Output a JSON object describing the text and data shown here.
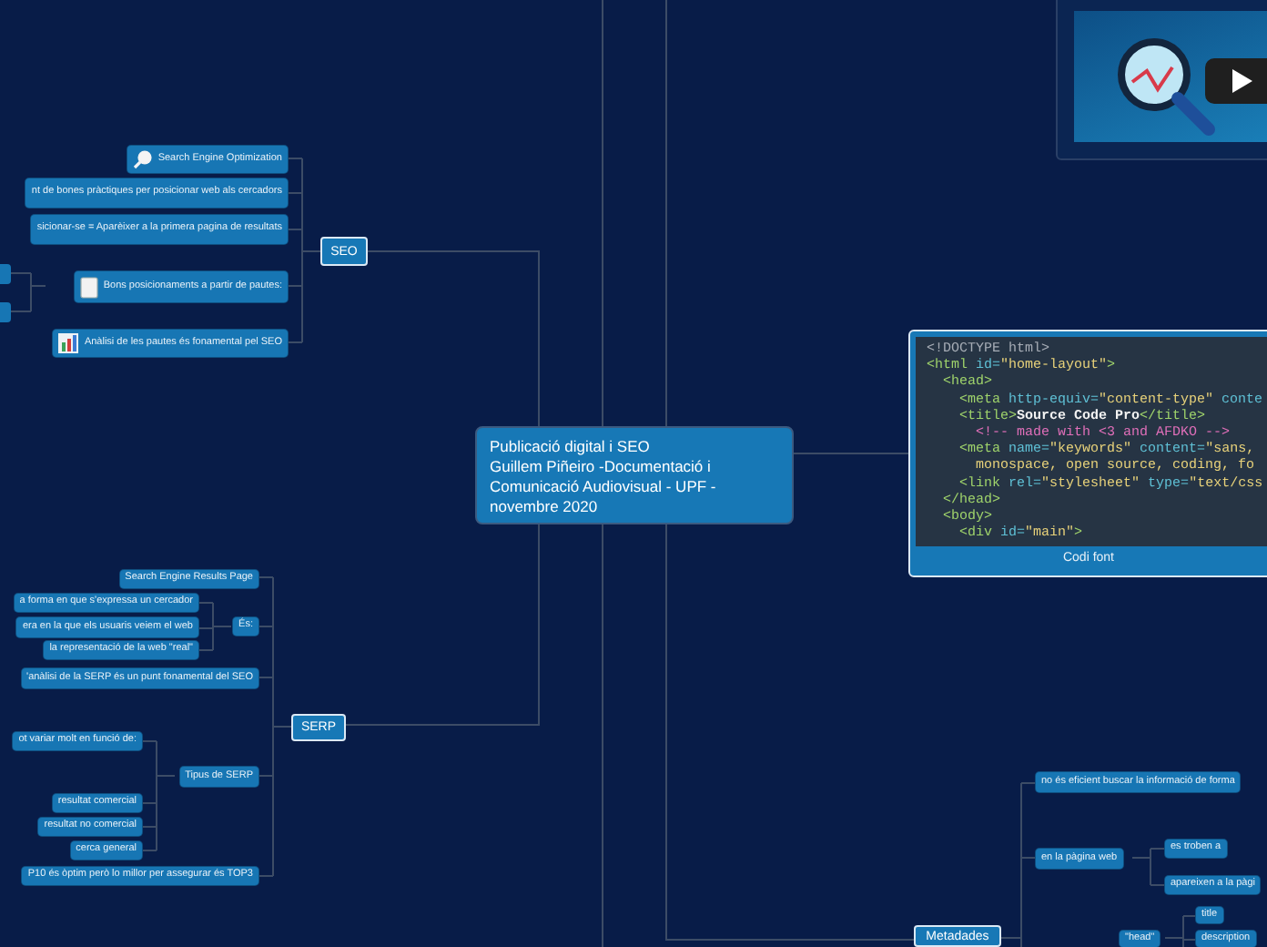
{
  "central_topic": {
    "text": "Publicació digital i SEO\nGuillem Piñeiro -Documentació i\nComunicació Audiovisual - UPF -\nnovembre 2020"
  },
  "nodes": [
    {
      "kind": "topic",
      "text": "Search Engine Optimization"
    },
    {
      "kind": "topic",
      "text": "nt de bones pràctiques per posicionar web als cercadors"
    },
    {
      "kind": "topic",
      "text": "sicionar-se = Aparèixer a la primera pagina de resultats"
    },
    {
      "kind": "main",
      "text": "SEO"
    },
    {
      "kind": "topic",
      "text": "Bons posicionaments a partir de pautes:"
    },
    {
      "kind": "topic",
      "text": "Anàlisi de les pautes és fonamental pel SEO"
    },
    {
      "kind": "topic",
      "text": "Search Engine Results Page"
    },
    {
      "kind": "topic",
      "text": "a forma en que s'expressa un cercador"
    },
    {
      "kind": "topic",
      "text": "era en la que els usuaris veiem el web"
    },
    {
      "kind": "topic",
      "text": "la representació de la web \"real\""
    },
    {
      "kind": "topic",
      "text": "És:"
    },
    {
      "kind": "topic",
      "text": "'anàlisi de la SERP és un punt fonamental del SEO"
    },
    {
      "kind": "main",
      "text": "SERP"
    },
    {
      "kind": "topic",
      "text": "ot variar molt en funció de:"
    },
    {
      "kind": "topic",
      "text": "Tipus de SERP"
    },
    {
      "kind": "topic",
      "text": "resultat comercial"
    },
    {
      "kind": "topic",
      "text": "resultat no comercial"
    },
    {
      "kind": "topic",
      "text": "cerca general"
    },
    {
      "kind": "topic",
      "text": "P10 és òptim però lo millor per assegurar és TOP3"
    },
    {
      "kind": "main",
      "text": "Metadades"
    },
    {
      "kind": "topic",
      "text": "no és eficient buscar la informació de forma"
    },
    {
      "kind": "topic",
      "text": "en la pàgina web"
    },
    {
      "kind": "topic",
      "text": "es troben a"
    },
    {
      "kind": "topic",
      "text": "apareixen a la pàgi"
    },
    {
      "kind": "topic",
      "text": "\"head\""
    },
    {
      "kind": "topic",
      "text": "title"
    },
    {
      "kind": "topic",
      "text": "description"
    }
  ],
  "code_node": {
    "caption": "Codi font",
    "lines": [
      [
        {
          "kind": "doctype",
          "text": "<!DOCTYPE html>"
        }
      ],
      [
        {
          "kind": "tag",
          "text": "<html "
        },
        {
          "kind": "attr",
          "text": "id="
        },
        {
          "kind": "string",
          "text": "\"home-layout\""
        },
        {
          "kind": "tag",
          "text": ">"
        }
      ],
      [
        {
          "kind": "tag",
          "text": "  <head>"
        }
      ],
      [
        {
          "kind": "tag",
          "text": "    <meta "
        },
        {
          "kind": "attr",
          "text": "http-equiv="
        },
        {
          "kind": "string",
          "text": "\"content-type\""
        },
        {
          "kind": "attr",
          "text": " conte"
        }
      ],
      [
        {
          "kind": "tag",
          "text": "    <title>"
        },
        {
          "kind": "text",
          "text": "Source Code Pro"
        },
        {
          "kind": "tag",
          "text": "</title>"
        }
      ],
      [
        {
          "kind": "comment",
          "text": "      <!-- made with <3 and AFDKO -->"
        }
      ],
      [
        {
          "kind": "tag",
          "text": "    <meta "
        },
        {
          "kind": "attr",
          "text": "name="
        },
        {
          "kind": "string",
          "text": "\"keywords\""
        },
        {
          "kind": "attr",
          "text": " content="
        },
        {
          "kind": "string",
          "text": "\"sans,"
        }
      ],
      [
        {
          "kind": "string",
          "text": "      monospace, open source, coding, fo"
        }
      ],
      [
        {
          "kind": "tag",
          "text": "    <link "
        },
        {
          "kind": "attr",
          "text": "rel="
        },
        {
          "kind": "string",
          "text": "\"stylesheet\""
        },
        {
          "kind": "attr",
          "text": " type="
        },
        {
          "kind": "string",
          "text": "\"text/css"
        }
      ],
      [
        {
          "kind": "tag",
          "text": "  </head>"
        }
      ],
      [
        {
          "kind": "tag",
          "text": "  <body>"
        }
      ],
      [
        {
          "kind": "tag",
          "text": "    <div "
        },
        {
          "kind": "attr",
          "text": "id="
        },
        {
          "kind": "string",
          "text": "\"main\""
        },
        {
          "kind": "tag",
          "text": ">"
        }
      ]
    ]
  }
}
